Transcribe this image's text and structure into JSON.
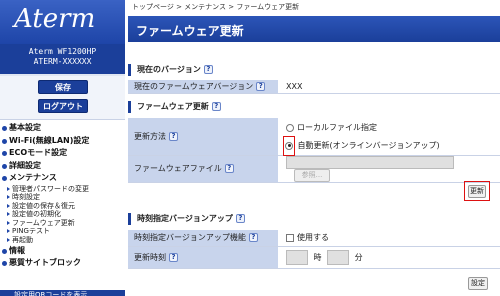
{
  "sidebar": {
    "logo": "Aterm",
    "model": "Aterm WF1200HP",
    "device_id": "ATERM-XXXXXX",
    "save_label": "保存",
    "logout_label": "ログアウト",
    "menu": [
      {
        "label": "基本設定"
      },
      {
        "label": "Wi-Fi(無線LAN)設定"
      },
      {
        "label": "ECOモード設定"
      },
      {
        "label": "詳細設定"
      },
      {
        "label": "メンテナンス"
      }
    ],
    "sub_items": [
      {
        "label": "管理者パスワードの変更"
      },
      {
        "label": "時刻設定"
      },
      {
        "label": "設定値の保存＆復元"
      },
      {
        "label": "設定値の初期化"
      },
      {
        "label": "ファームウェア更新"
      },
      {
        "label": "PINGテスト"
      },
      {
        "label": "再起動"
      }
    ],
    "menu_after": [
      {
        "label": "情報"
      },
      {
        "label": "悪質サイトブロック"
      }
    ],
    "qr_label": "設定用QRコードを表示"
  },
  "breadcrumb": "トップページ > メンテナンス > ファームウェア更新",
  "page_title": "ファームウェア更新",
  "current_version": {
    "header": "現在のバージョン",
    "label": "現在のファームウェアバージョン",
    "value": "XXX"
  },
  "firmware_update": {
    "header": "ファームウェア更新",
    "method_label": "更新方法",
    "option_local": "ローカルファイル指定",
    "option_auto": "自動更新(オンラインバージョンアップ)",
    "file_label": "ファームウェアファイル",
    "browse_label": "参照...",
    "update_button": "更新"
  },
  "scheduled": {
    "header": "時刻指定バージョンアップ",
    "feature_label": "時刻指定バージョンアップ機能",
    "use_label": "使用する",
    "time_label": "更新時刻",
    "hour_unit": "時",
    "minute_unit": "分",
    "apply_button": "設定"
  }
}
